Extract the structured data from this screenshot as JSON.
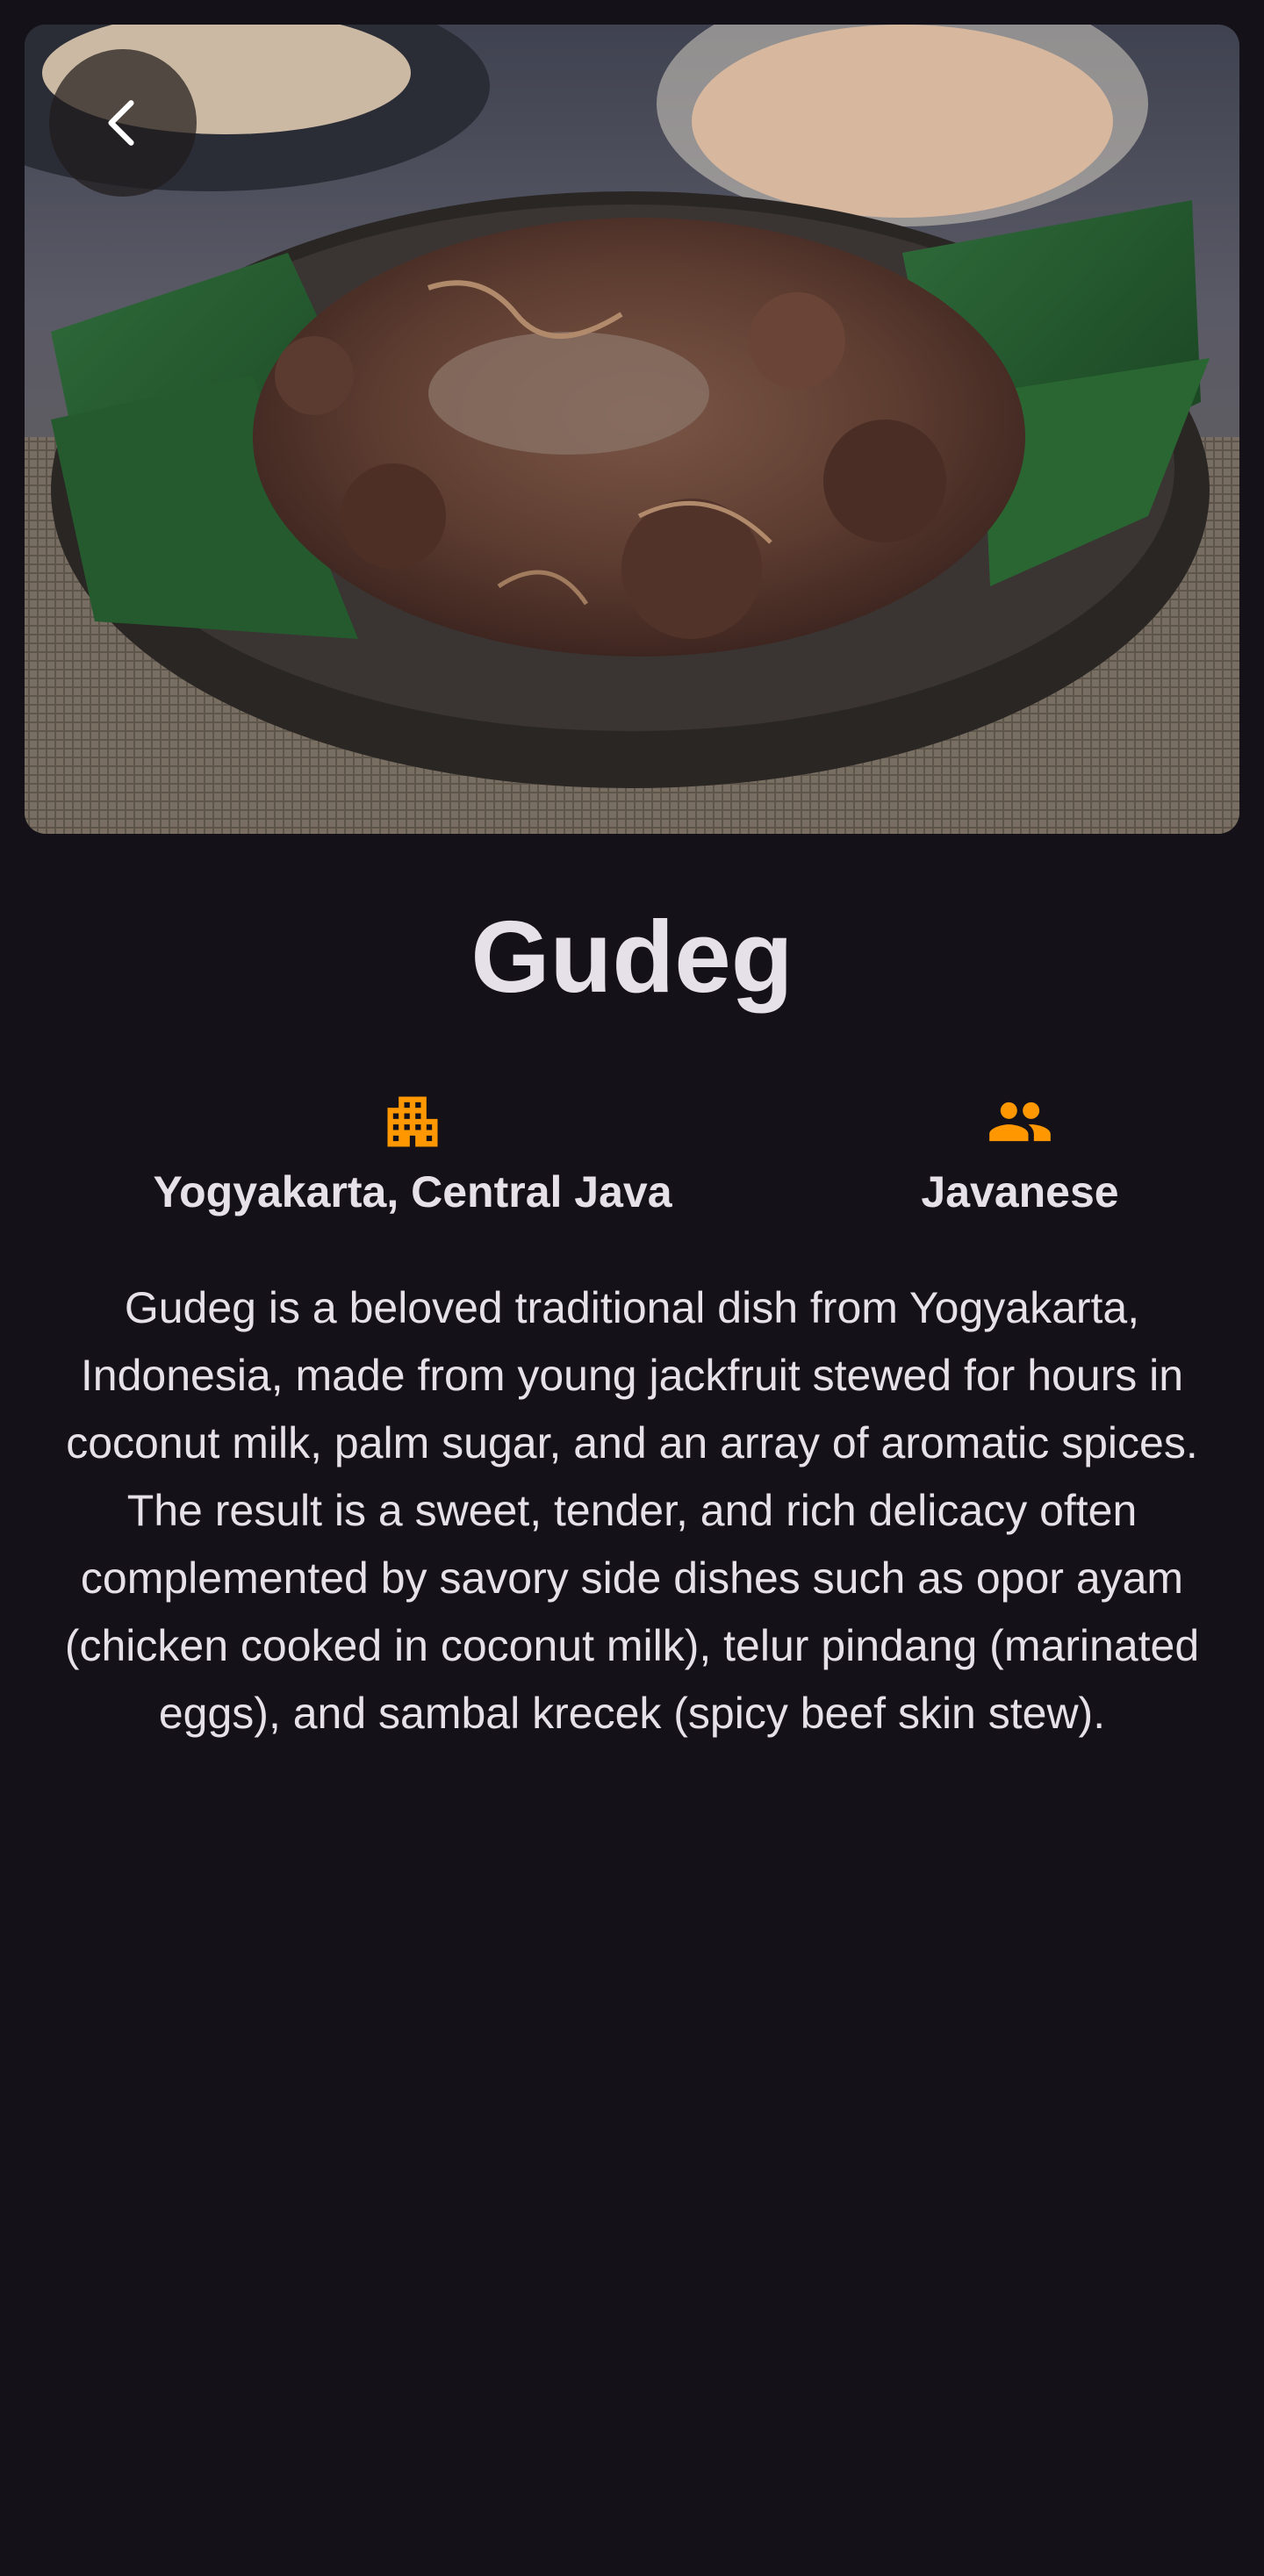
{
  "dish": {
    "title": "Gudeg",
    "location": "Yogyakarta, Central Java",
    "ethnicity": "Javanese",
    "description": "Gudeg is a beloved traditional dish from Yogyakarta, Indonesia, made from young jackfruit stewed for hours in coconut milk, palm sugar, and an array of aromatic spices. The result is a sweet, tender, and rich delicacy often complemented by savory side dishes such as opor ayam (chicken cooked in coconut milk), telur pindang (marinated eggs), and sambal krecek (spicy beef skin stew)."
  },
  "icons": {
    "back": "chevron-left-icon",
    "location": "apartment-building-icon",
    "ethnicity": "people-group-icon"
  },
  "colors": {
    "background": "#141218",
    "text": "#E6E0E9",
    "accent": "#FF9800"
  }
}
